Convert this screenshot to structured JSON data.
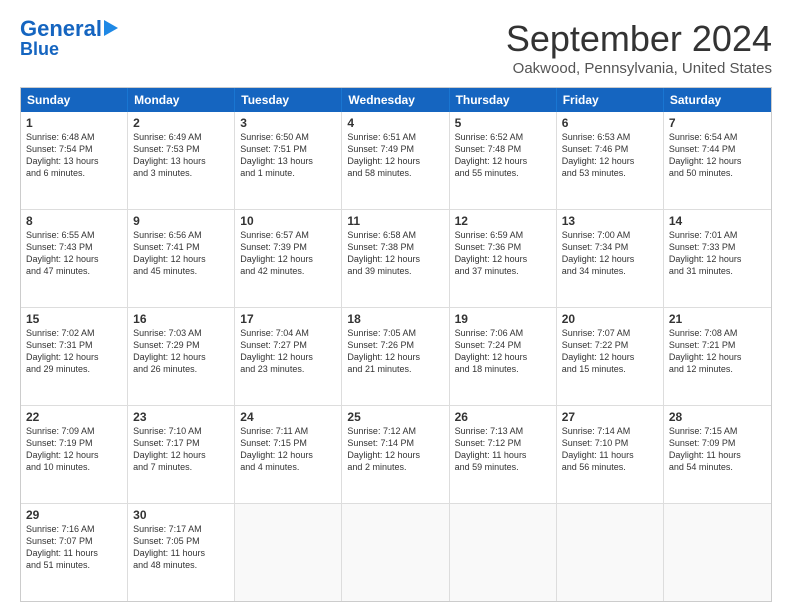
{
  "logo": {
    "line1": "General",
    "line2": "Blue"
  },
  "title": "September 2024",
  "subtitle": "Oakwood, Pennsylvania, United States",
  "days": [
    "Sunday",
    "Monday",
    "Tuesday",
    "Wednesday",
    "Thursday",
    "Friday",
    "Saturday"
  ],
  "weeks": [
    [
      {
        "day": "1",
        "info": "Sunrise: 6:48 AM\nSunset: 7:54 PM\nDaylight: 13 hours\nand 6 minutes."
      },
      {
        "day": "2",
        "info": "Sunrise: 6:49 AM\nSunset: 7:53 PM\nDaylight: 13 hours\nand 3 minutes."
      },
      {
        "day": "3",
        "info": "Sunrise: 6:50 AM\nSunset: 7:51 PM\nDaylight: 13 hours\nand 1 minute."
      },
      {
        "day": "4",
        "info": "Sunrise: 6:51 AM\nSunset: 7:49 PM\nDaylight: 12 hours\nand 58 minutes."
      },
      {
        "day": "5",
        "info": "Sunrise: 6:52 AM\nSunset: 7:48 PM\nDaylight: 12 hours\nand 55 minutes."
      },
      {
        "day": "6",
        "info": "Sunrise: 6:53 AM\nSunset: 7:46 PM\nDaylight: 12 hours\nand 53 minutes."
      },
      {
        "day": "7",
        "info": "Sunrise: 6:54 AM\nSunset: 7:44 PM\nDaylight: 12 hours\nand 50 minutes."
      }
    ],
    [
      {
        "day": "8",
        "info": "Sunrise: 6:55 AM\nSunset: 7:43 PM\nDaylight: 12 hours\nand 47 minutes."
      },
      {
        "day": "9",
        "info": "Sunrise: 6:56 AM\nSunset: 7:41 PM\nDaylight: 12 hours\nand 45 minutes."
      },
      {
        "day": "10",
        "info": "Sunrise: 6:57 AM\nSunset: 7:39 PM\nDaylight: 12 hours\nand 42 minutes."
      },
      {
        "day": "11",
        "info": "Sunrise: 6:58 AM\nSunset: 7:38 PM\nDaylight: 12 hours\nand 39 minutes."
      },
      {
        "day": "12",
        "info": "Sunrise: 6:59 AM\nSunset: 7:36 PM\nDaylight: 12 hours\nand 37 minutes."
      },
      {
        "day": "13",
        "info": "Sunrise: 7:00 AM\nSunset: 7:34 PM\nDaylight: 12 hours\nand 34 minutes."
      },
      {
        "day": "14",
        "info": "Sunrise: 7:01 AM\nSunset: 7:33 PM\nDaylight: 12 hours\nand 31 minutes."
      }
    ],
    [
      {
        "day": "15",
        "info": "Sunrise: 7:02 AM\nSunset: 7:31 PM\nDaylight: 12 hours\nand 29 minutes."
      },
      {
        "day": "16",
        "info": "Sunrise: 7:03 AM\nSunset: 7:29 PM\nDaylight: 12 hours\nand 26 minutes."
      },
      {
        "day": "17",
        "info": "Sunrise: 7:04 AM\nSunset: 7:27 PM\nDaylight: 12 hours\nand 23 minutes."
      },
      {
        "day": "18",
        "info": "Sunrise: 7:05 AM\nSunset: 7:26 PM\nDaylight: 12 hours\nand 21 minutes."
      },
      {
        "day": "19",
        "info": "Sunrise: 7:06 AM\nSunset: 7:24 PM\nDaylight: 12 hours\nand 18 minutes."
      },
      {
        "day": "20",
        "info": "Sunrise: 7:07 AM\nSunset: 7:22 PM\nDaylight: 12 hours\nand 15 minutes."
      },
      {
        "day": "21",
        "info": "Sunrise: 7:08 AM\nSunset: 7:21 PM\nDaylight: 12 hours\nand 12 minutes."
      }
    ],
    [
      {
        "day": "22",
        "info": "Sunrise: 7:09 AM\nSunset: 7:19 PM\nDaylight: 12 hours\nand 10 minutes."
      },
      {
        "day": "23",
        "info": "Sunrise: 7:10 AM\nSunset: 7:17 PM\nDaylight: 12 hours\nand 7 minutes."
      },
      {
        "day": "24",
        "info": "Sunrise: 7:11 AM\nSunset: 7:15 PM\nDaylight: 12 hours\nand 4 minutes."
      },
      {
        "day": "25",
        "info": "Sunrise: 7:12 AM\nSunset: 7:14 PM\nDaylight: 12 hours\nand 2 minutes."
      },
      {
        "day": "26",
        "info": "Sunrise: 7:13 AM\nSunset: 7:12 PM\nDaylight: 11 hours\nand 59 minutes."
      },
      {
        "day": "27",
        "info": "Sunrise: 7:14 AM\nSunset: 7:10 PM\nDaylight: 11 hours\nand 56 minutes."
      },
      {
        "day": "28",
        "info": "Sunrise: 7:15 AM\nSunset: 7:09 PM\nDaylight: 11 hours\nand 54 minutes."
      }
    ],
    [
      {
        "day": "29",
        "info": "Sunrise: 7:16 AM\nSunset: 7:07 PM\nDaylight: 11 hours\nand 51 minutes."
      },
      {
        "day": "30",
        "info": "Sunrise: 7:17 AM\nSunset: 7:05 PM\nDaylight: 11 hours\nand 48 minutes."
      },
      {
        "day": "",
        "info": ""
      },
      {
        "day": "",
        "info": ""
      },
      {
        "day": "",
        "info": ""
      },
      {
        "day": "",
        "info": ""
      },
      {
        "day": "",
        "info": ""
      }
    ]
  ]
}
